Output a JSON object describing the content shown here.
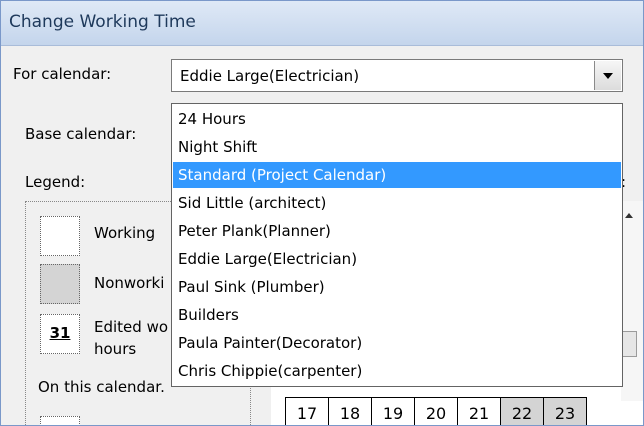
{
  "window": {
    "title": "Change Working Time"
  },
  "form": {
    "for_calendar_label": "For calendar:",
    "for_calendar_value": "Eddie Large(Electrician)",
    "base_calendar_label": "Base calendar:",
    "legend_label": "Legend:",
    "right_colon": ":"
  },
  "legend": {
    "working_label": "Working",
    "nonworking_label": "Nonworki",
    "edited_number": "31",
    "edited_label_line1": "Edited wo",
    "edited_label_line2": "hours",
    "on_this_calendar_label": "On this calendar."
  },
  "dropdown": {
    "options": [
      "24 Hours",
      "Night Shift",
      "Standard (Project Calendar)",
      "Sid Little (architect)",
      "Peter Plank(Planner)",
      "Eddie Large(Electrician)",
      "Paul Sink (Plumber)",
      "Builders",
      "Paula Painter(Decorator)",
      "Chris Chippie(carpenter)"
    ],
    "highlighted_index": 2
  },
  "calendar": {
    "visible_days": [
      "17",
      "18",
      "19",
      "20",
      "21",
      "22",
      "23"
    ],
    "weekend_days": [
      "22",
      "23"
    ]
  },
  "colors": {
    "highlight": "#3399ff",
    "title_text": "#1e395b",
    "nonworking": "#d4d4d4"
  }
}
